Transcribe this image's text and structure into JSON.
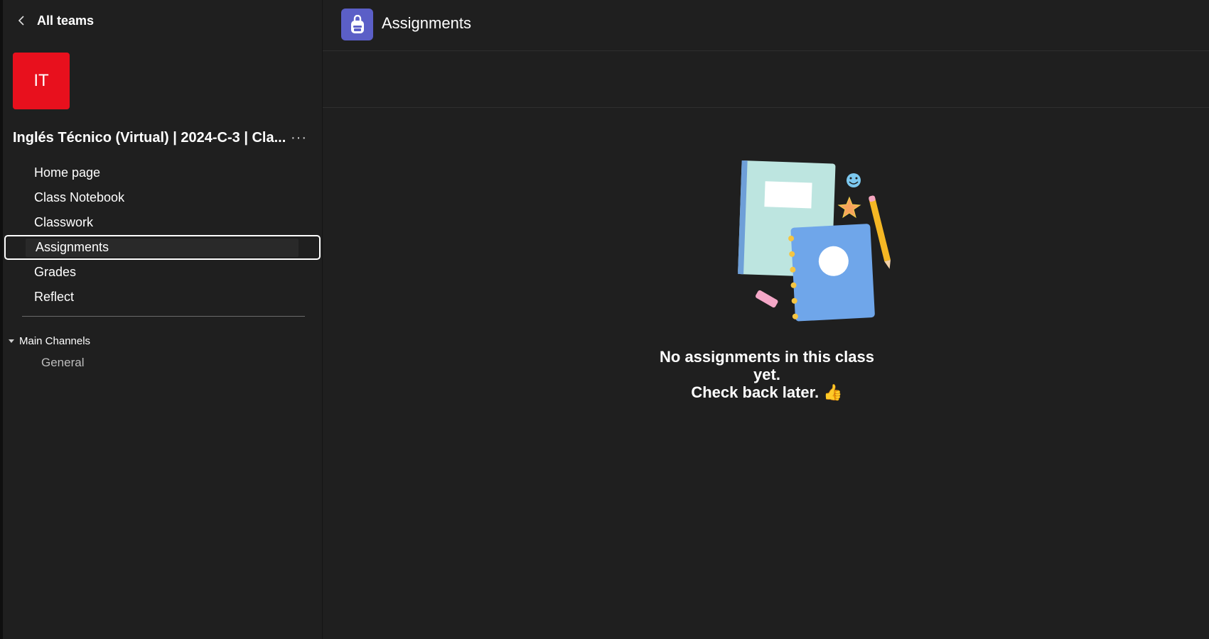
{
  "sidebar": {
    "back_label": "All teams",
    "avatar_text": "IT",
    "avatar_color": "#e8101d",
    "team_name": "Inglés Técnico (Virtual) | 2024-C-3 | Cla...",
    "more_label": "···",
    "nav_items": [
      {
        "label": "Home page"
      },
      {
        "label": "Class Notebook"
      },
      {
        "label": "Classwork"
      },
      {
        "label": "Assignments",
        "active": true
      },
      {
        "label": "Grades"
      },
      {
        "label": "Reflect"
      }
    ],
    "channels_header": "Main Channels",
    "channels": [
      {
        "label": "General"
      }
    ]
  },
  "main": {
    "title": "Assignments",
    "app_icon": "backpack-icon",
    "accent_color": "#5b5fc7",
    "empty_line1": "No assignments in this class yet.",
    "empty_line2": "Check back later. 👍"
  }
}
